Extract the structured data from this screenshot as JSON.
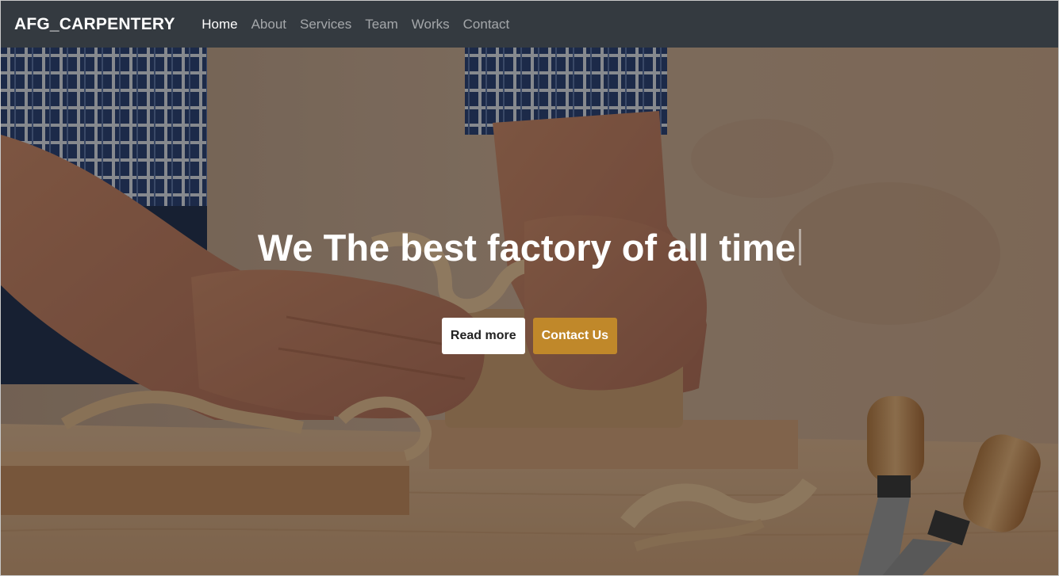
{
  "navbar": {
    "brand": "AFG_CARPENTERY",
    "links": [
      {
        "label": "Home",
        "active": true
      },
      {
        "label": "About",
        "active": false
      },
      {
        "label": "Services",
        "active": false
      },
      {
        "label": "Team",
        "active": false
      },
      {
        "label": "Works",
        "active": false
      },
      {
        "label": "Contact",
        "active": false
      }
    ]
  },
  "hero": {
    "title": "We The best factory of all time",
    "buttons": {
      "read_more": "Read more",
      "contact": "Contact Us"
    }
  },
  "colors": {
    "navbar_bg": "#343a40",
    "accent": "#c0882a",
    "nav_active": "#ffffff",
    "nav_muted": "rgba(255,255,255,0.55)"
  }
}
